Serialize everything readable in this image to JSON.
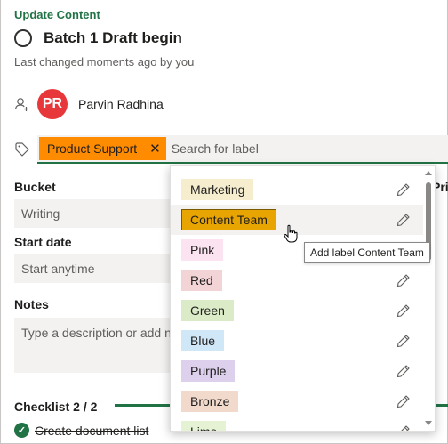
{
  "header": {
    "breadcrumb": "Update Content",
    "task_title": "Batch 1 Draft begin",
    "changed_text": "Last changed moments ago by you"
  },
  "assignee": {
    "initials": "PR",
    "name": "Parvin Radhina",
    "avatar_color": "#e8373b"
  },
  "labels": {
    "applied": [
      {
        "text": "Product Support",
        "color": "#ff8c00"
      }
    ],
    "search_placeholder": "Search for label"
  },
  "fields": {
    "bucket_label": "Bucket",
    "bucket_value": "Writing",
    "priority_label": "Pric",
    "start_date_label": "Start date",
    "start_date_value": "Start anytime",
    "notes_label": "Notes",
    "notes_placeholder": "Type a description or add n"
  },
  "checklist": {
    "label": "Checklist 2 / 2",
    "items": [
      {
        "text": "Create document list",
        "done": true
      }
    ],
    "accent": "#217346"
  },
  "dropdown": {
    "items": [
      {
        "label": "Marketing",
        "color": "#f5edce",
        "edit": true
      },
      {
        "label": "Content Team",
        "color": "#e8a400",
        "edit": true,
        "hovered": true,
        "selected": true
      },
      {
        "label": "Pink",
        "color": "#fbe3f1",
        "edit": false
      },
      {
        "label": "Red",
        "color": "#f2d4d7",
        "edit": true
      },
      {
        "label": "Green",
        "color": "#dbebc7",
        "edit": true
      },
      {
        "label": "Blue",
        "color": "#d0e7f8",
        "edit": true
      },
      {
        "label": "Purple",
        "color": "#dcd0ed",
        "edit": true
      },
      {
        "label": "Bronze",
        "color": "#f1d9cc",
        "edit": true
      },
      {
        "label": "Lime",
        "color": "#e5f2d3",
        "edit": true
      }
    ],
    "tooltip": "Add label Content Team"
  }
}
